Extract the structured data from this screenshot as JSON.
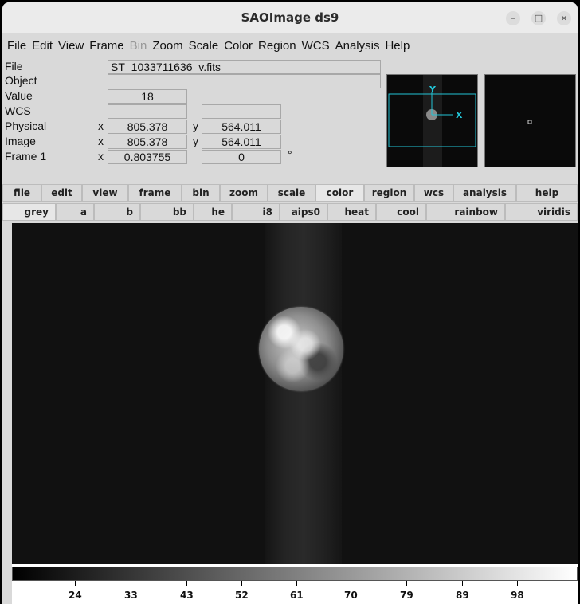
{
  "window": {
    "title": "SAOImage ds9",
    "min_glyph": "–",
    "max_glyph": "□",
    "close_glyph": "×"
  },
  "menu": [
    "File",
    "Edit",
    "View",
    "Frame",
    "Bin",
    "Zoom",
    "Scale",
    "Color",
    "Region",
    "WCS",
    "Analysis",
    "Help"
  ],
  "info": {
    "file_label": "File",
    "file_value": "ST_1033711636_v.fits",
    "object_label": "Object",
    "object_value": "",
    "value_label": "Value",
    "value_value": "18",
    "wcs_label": "WCS",
    "physical_label": "Physical",
    "physical_x": "805.378",
    "physical_y": "564.011",
    "image_label": "Image",
    "image_x": "805.378",
    "image_y": "564.011",
    "frame_label": "Frame 1",
    "frame_zoom": "0.803755",
    "frame_angle": "0",
    "degree": "°",
    "x_axis": "x",
    "y_axis": "y"
  },
  "panner": {
    "x_label": "X",
    "y_label": "Y"
  },
  "buttonbar": [
    "file",
    "edit",
    "view",
    "frame",
    "bin",
    "zoom",
    "scale",
    "color",
    "region",
    "wcs",
    "analysis",
    "help"
  ],
  "buttonbar_active": "color",
  "cmapbar": [
    "grey",
    "a",
    "b",
    "bb",
    "he",
    "i8",
    "aips0",
    "heat",
    "cool",
    "rainbow",
    "viridis"
  ],
  "colorbar_ticks": [
    "24",
    "33",
    "43",
    "52",
    "61",
    "70",
    "79",
    "89",
    "98"
  ],
  "colors": {
    "panner_box": "#22c4d6",
    "chrome": "#d9d9d9"
  }
}
